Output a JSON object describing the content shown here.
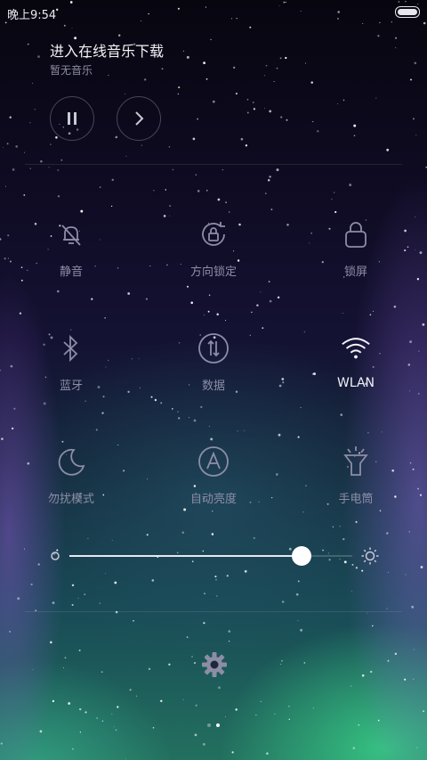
{
  "status_bar": {
    "time": "晚上9:54",
    "battery_level_fraction": 1.0
  },
  "music": {
    "title": "进入在线音乐下载",
    "subtitle": "暂无音乐",
    "controls": [
      {
        "icon": "pause-icon"
      },
      {
        "icon": "next-icon"
      }
    ]
  },
  "toggles": [
    {
      "label": "静音",
      "icon": "silent-bell-icon",
      "active": false
    },
    {
      "label": "方向锁定",
      "icon": "rotation-lock-icon",
      "active": false
    },
    {
      "label": "锁屏",
      "icon": "lock-icon",
      "active": false
    },
    {
      "label": "蓝牙",
      "icon": "bluetooth-icon",
      "active": false
    },
    {
      "label": "数据",
      "icon": "mobile-data-icon",
      "active": false
    },
    {
      "label": "WLAN",
      "icon": "wifi-icon",
      "active": true
    },
    {
      "label": "勿扰模式",
      "icon": "moon-icon",
      "active": false
    },
    {
      "label": "自动亮度",
      "icon": "auto-brightness-icon",
      "active": false
    },
    {
      "label": "手电筒",
      "icon": "flashlight-icon",
      "active": false
    }
  ],
  "brightness": {
    "level_fraction": 0.82,
    "min_icon": "brightness-low-icon",
    "max_icon": "brightness-high-icon"
  },
  "settings": {
    "icon": "gear-icon"
  },
  "pager": {
    "pages": 2,
    "current": 2
  },
  "colors": {
    "active": "#f2f2f8",
    "inactive": "#8d8da6"
  }
}
